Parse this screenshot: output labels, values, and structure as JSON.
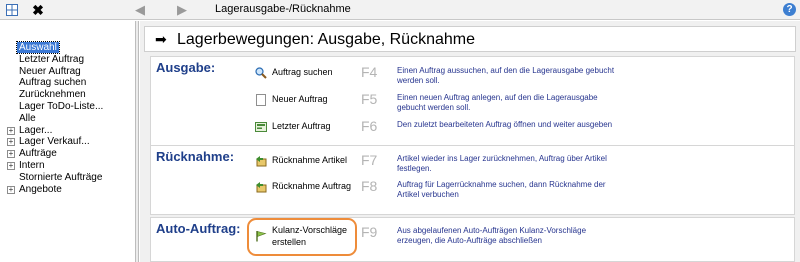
{
  "toolbar": {
    "breadcrumb": "Lagerausgabe-/Rücknahme",
    "help_glyph": "?",
    "close_glyph": "✖",
    "back_glyph": "◀",
    "forward_glyph": "▶"
  },
  "sidebar": {
    "items": [
      {
        "label": "Auswahl",
        "selected": true,
        "expandable": false
      },
      {
        "label": "Letzter Auftrag",
        "selected": false,
        "expandable": false
      },
      {
        "label": "Neuer Auftrag",
        "selected": false,
        "expandable": false
      },
      {
        "label": "Auftrag suchen",
        "selected": false,
        "expandable": false
      },
      {
        "label": "Zurücknehmen",
        "selected": false,
        "expandable": false
      },
      {
        "label": "Lager ToDo-Liste...",
        "selected": false,
        "expandable": false
      },
      {
        "label": "Alle",
        "selected": false,
        "expandable": false
      },
      {
        "label": "Lager...",
        "selected": false,
        "expandable": true
      },
      {
        "label": "Lager Verkauf...",
        "selected": false,
        "expandable": true
      },
      {
        "label": "Aufträge",
        "selected": false,
        "expandable": true
      },
      {
        "label": "Intern",
        "selected": false,
        "expandable": true
      },
      {
        "label": "Stornierte Aufträge",
        "selected": false,
        "expandable": false
      },
      {
        "label": "Angebote",
        "selected": false,
        "expandable": true
      }
    ],
    "expand_glyph": "+"
  },
  "main": {
    "title": "Lagerbewegungen: Ausgabe, Rücknahme",
    "title_arrow": "➡",
    "sections": {
      "ausgabe": {
        "heading": "Ausgabe:",
        "actions": [
          {
            "label": "Auftrag suchen",
            "key": "F4",
            "desc": "Einen Auftrag aussuchen, auf den die Lagerausgabe gebucht werden soll.",
            "icon": "magnifier-icon"
          },
          {
            "label": "Neuer Auftrag",
            "key": "F5",
            "desc": "Einen neuen Auftrag anlegen, auf den die Lagerausgabe gebucht werden soll.",
            "icon": "blank-page-icon"
          },
          {
            "label": "Letzter Auftrag",
            "key": "F6",
            "desc": "Den zuletzt bearbeiteten Auftrag öffnen und weiter ausgeben",
            "icon": "recent-order-icon"
          }
        ]
      },
      "ruecknahme": {
        "heading": "Rücknahme:",
        "actions": [
          {
            "label": "Rücknahme Artikel",
            "key": "F7",
            "desc": "Artikel wieder ins Lager zurücknehmen, Auftrag über Artikel festlegen.",
            "icon": "return-item-icon"
          },
          {
            "label": "Rücknahme Auftrag",
            "key": "F8",
            "desc": "Auftrag für Lagerrücknahme suchen, dann Rücknahme der Artikel verbuchen",
            "icon": "return-order-icon"
          }
        ]
      },
      "auto": {
        "heading": "Auto-Auftrag:",
        "actions": [
          {
            "label": "Kulanz-Vorschläge erstellen",
            "label_line1": "Kulanz-Vorschläge",
            "label_line2": "erstellen",
            "key": "F9",
            "desc": "Aus abgelaufenen Auto-Aufträgen Kulanz-Vorschläge erzeugen, die Auto-Aufträge abschließen",
            "icon": "flag-icon",
            "highlighted": true
          }
        ]
      }
    }
  },
  "colors": {
    "heading": "#1f3f8a",
    "description": "#27358f",
    "shortcut_key": "#b4b4b4",
    "selection": "#3b78d4",
    "highlight_ring": "#ee8c3a"
  }
}
